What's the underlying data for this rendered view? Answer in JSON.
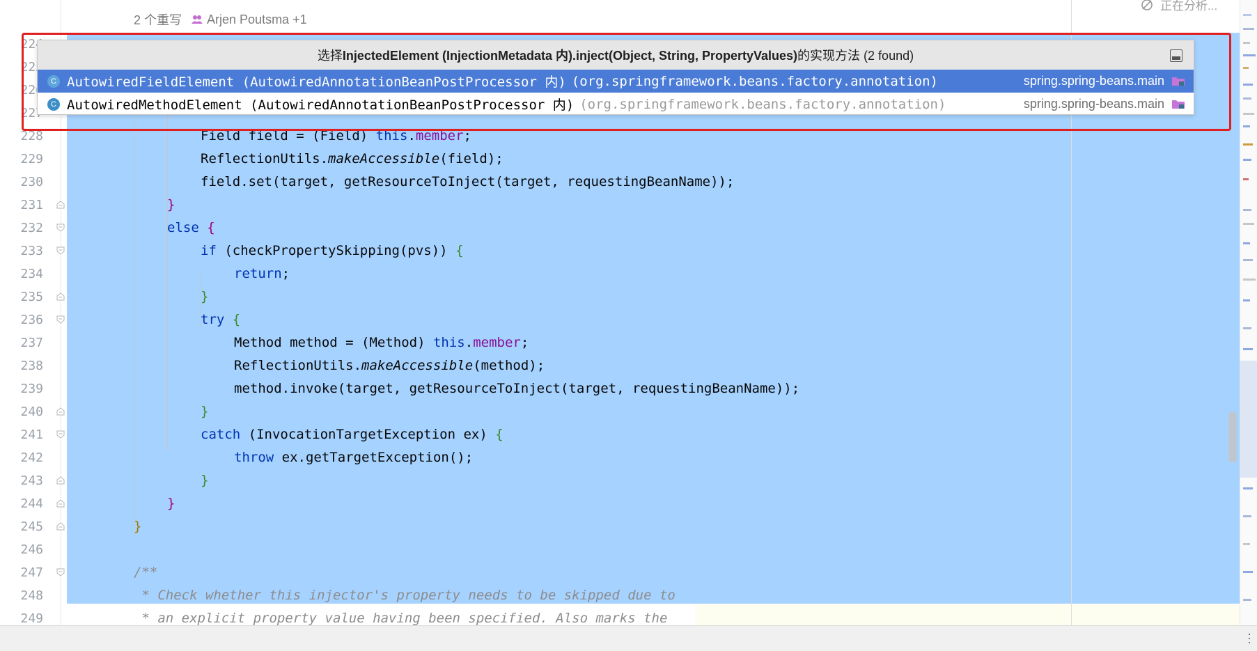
{
  "editor": {
    "overlap_info": {
      "overrides": "2 个重写",
      "authors": "Arjen Poutsma +1"
    },
    "status_text": "正在分析...",
    "lines": [
      {
        "num": "224"
      },
      {
        "num": "225"
      },
      {
        "num": "226"
      },
      {
        "num": "227"
      },
      {
        "num": "228",
        "code": [
          [
            "Field field = (Field) ",
            ""
          ],
          [
            "this",
            "kw"
          ],
          [
            ".",
            ""
          ],
          [
            "member",
            "fld"
          ],
          [
            ";",
            ""
          ]
        ]
      },
      {
        "num": "229",
        "code": [
          [
            "ReflectionUtils.",
            ""
          ],
          [
            "makeAccessible",
            "it"
          ],
          [
            "(field);",
            ""
          ]
        ]
      },
      {
        "num": "230",
        "code": [
          [
            "field.set(target, getResourceToInject(target, requestingBeanName));",
            ""
          ]
        ]
      },
      {
        "num": "231",
        "code": [
          [
            "}",
            "pm"
          ]
        ]
      },
      {
        "num": "232",
        "code": [
          [
            "else ",
            "kw"
          ],
          [
            "{",
            "pm"
          ]
        ]
      },
      {
        "num": "233",
        "code": [
          [
            "if ",
            "kw"
          ],
          [
            "(checkPropertySkipping(pvs)) ",
            ""
          ],
          [
            "{",
            "pg"
          ]
        ]
      },
      {
        "num": "234",
        "code": [
          [
            "return",
            "kw"
          ],
          [
            ";",
            ""
          ]
        ]
      },
      {
        "num": "235",
        "code": [
          [
            "}",
            "pg"
          ]
        ]
      },
      {
        "num": "236",
        "code": [
          [
            "try ",
            "kw"
          ],
          [
            "{",
            "pg"
          ]
        ]
      },
      {
        "num": "237",
        "code": [
          [
            "Method method = (Method) ",
            ""
          ],
          [
            "this",
            "kw"
          ],
          [
            ".",
            ""
          ],
          [
            "member",
            "fld"
          ],
          [
            ";",
            ""
          ]
        ]
      },
      {
        "num": "238",
        "code": [
          [
            "ReflectionUtils.",
            ""
          ],
          [
            "makeAccessible",
            "it"
          ],
          [
            "(method);",
            ""
          ]
        ]
      },
      {
        "num": "239",
        "code": [
          [
            "method.invoke(target, getResourceToInject(target, requestingBeanName));",
            ""
          ]
        ]
      },
      {
        "num": "240",
        "code": [
          [
            "}",
            "pg"
          ]
        ]
      },
      {
        "num": "241",
        "code": [
          [
            "catch ",
            "kw"
          ],
          [
            "(InvocationTargetException ex) ",
            ""
          ],
          [
            "{",
            "pg"
          ]
        ]
      },
      {
        "num": "242",
        "code": [
          [
            "throw ",
            "kw"
          ],
          [
            "ex.getTargetException();",
            ""
          ]
        ]
      },
      {
        "num": "243",
        "code": [
          [
            "}",
            "pg"
          ]
        ]
      },
      {
        "num": "244",
        "code": [
          [
            "}",
            "pm"
          ]
        ]
      },
      {
        "num": "245",
        "code": [
          [
            "}",
            "py"
          ]
        ]
      },
      {
        "num": "246"
      },
      {
        "num": "247",
        "code": [
          [
            "/**",
            "cm"
          ]
        ]
      },
      {
        "num": "248",
        "code": [
          [
            " * Check whether this injector's property needs to be skipped due to",
            "cm"
          ]
        ]
      },
      {
        "num": "249",
        "code": [
          [
            " * an explicit property value having been specified. Also marks the",
            "cm"
          ]
        ]
      }
    ]
  },
  "popup": {
    "title_prefix": "选择",
    "title_bold": "InjectedElement (InjectionMetadata 内).inject(Object, String, PropertyValues)",
    "title_suffix": "的实现方法 (2 found)",
    "items": [
      {
        "icon": "C",
        "name": "AutowiredFieldElement (AutowiredAnnotationBeanPostProcessor 内)",
        "package": "(org.springframework.beans.factory.annotation)",
        "module": "spring.spring-beans.main",
        "selected": true
      },
      {
        "icon": "C",
        "name": "AutowiredMethodElement (AutowiredAnnotationBeanPostProcessor 内)",
        "package": "(org.springframework.beans.factory.annotation)",
        "module": "spring.spring-beans.main",
        "selected": false
      }
    ]
  },
  "colors": {
    "selection": "#a6d2ff",
    "popup_selected": "#4a7bd6",
    "highlight_border": "#e02020"
  }
}
